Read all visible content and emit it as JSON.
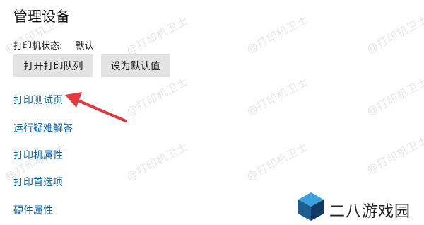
{
  "title": "管理设备",
  "status": {
    "label": "打印机状态:",
    "value": "默认"
  },
  "buttons": {
    "open_queue": "打开打印队列",
    "set_default": "设为默认值"
  },
  "links": [
    "打印测试页",
    "运行疑难解答",
    "打印机属性",
    "打印首选项",
    "硬件属性"
  ],
  "watermark": "@打印机卫士",
  "logo": {
    "icon": "cube-logo-icon",
    "text": "二八游戏园"
  },
  "colors": {
    "link": "#0067c0",
    "arrow": "#e8383d",
    "button_bg": "#e3e3e3"
  }
}
